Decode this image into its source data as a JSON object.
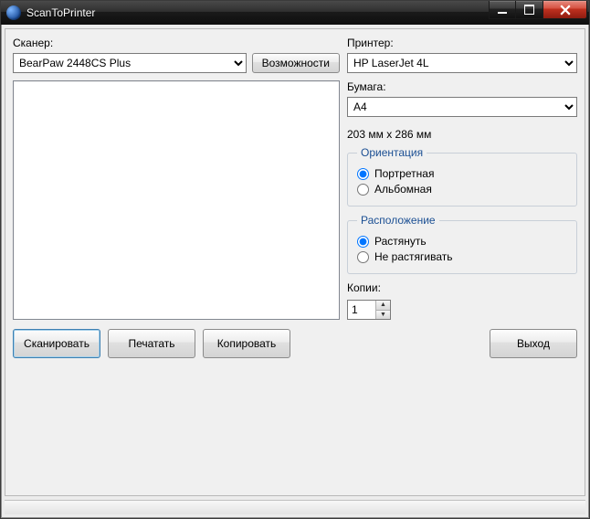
{
  "window": {
    "title": "ScanToPrinter"
  },
  "scanner": {
    "label": "Сканер:",
    "selected": "BearPaw 2448CS Plus",
    "capabilities_btn": "Возможности"
  },
  "printer": {
    "label": "Принтер:",
    "selected": "HP LaserJet 4L"
  },
  "paper": {
    "label": "Бумага:",
    "selected": "A4",
    "size_text": "203 мм x 286 мм"
  },
  "orientation": {
    "legend": "Ориентация",
    "portrait": "Портретная",
    "landscape": "Альбомная",
    "selected": "portrait"
  },
  "placement": {
    "legend": "Расположение",
    "stretch": "Растянуть",
    "nostretch": "Не растягивать",
    "selected": "stretch"
  },
  "copies": {
    "label": "Копии:",
    "value": "1"
  },
  "buttons": {
    "scan": "Сканировать",
    "print": "Печатать",
    "copy": "Копировать",
    "exit": "Выход"
  }
}
